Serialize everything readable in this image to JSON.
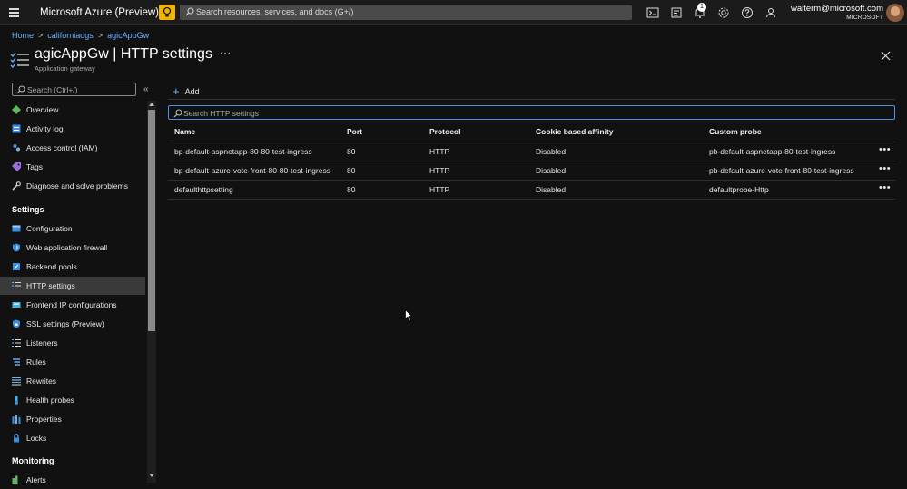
{
  "topbar": {
    "brand": "Microsoft Azure (Preview)",
    "search_placeholder": "Search resources, services, and docs (G+/)",
    "notification_count": "1",
    "account_email": "walterm@microsoft.com",
    "account_tenant": "MICROSOFT"
  },
  "breadcrumb": [
    "Home",
    "californiadgs",
    "agicAppGw"
  ],
  "header": {
    "title": "agicAppGw | HTTP settings",
    "subtitle": "Application gateway",
    "more": "···"
  },
  "sidebar": {
    "search_placeholder": "Search (Ctrl+/)",
    "collapse_glyph": "«",
    "top_items": [
      {
        "label": "Overview",
        "icon": "overview-icon"
      },
      {
        "label": "Activity log",
        "icon": "activity-log-icon"
      },
      {
        "label": "Access control (IAM)",
        "icon": "iam-icon"
      },
      {
        "label": "Tags",
        "icon": "tag-icon"
      },
      {
        "label": "Diagnose and solve problems",
        "icon": "wrench-icon"
      }
    ],
    "settings_heading": "Settings",
    "settings_items": [
      {
        "label": "Configuration",
        "icon": "configuration-icon"
      },
      {
        "label": "Web application firewall",
        "icon": "shield-icon"
      },
      {
        "label": "Backend pools",
        "icon": "backend-pools-icon"
      },
      {
        "label": "HTTP settings",
        "icon": "http-settings-icon",
        "active": true
      },
      {
        "label": "Frontend IP configurations",
        "icon": "frontend-ip-icon"
      },
      {
        "label": "SSL settings (Preview)",
        "icon": "ssl-shield-icon"
      },
      {
        "label": "Listeners",
        "icon": "listeners-icon"
      },
      {
        "label": "Rules",
        "icon": "rules-icon"
      },
      {
        "label": "Rewrites",
        "icon": "rewrites-icon"
      },
      {
        "label": "Health probes",
        "icon": "health-probe-icon"
      },
      {
        "label": "Properties",
        "icon": "properties-icon"
      },
      {
        "label": "Locks",
        "icon": "lock-icon"
      }
    ],
    "monitoring_heading": "Monitoring",
    "monitoring_items": [
      {
        "label": "Alerts",
        "icon": "alerts-icon"
      }
    ]
  },
  "commandbar": {
    "add_label": "Add"
  },
  "grid": {
    "search_placeholder": "Search HTTP settings",
    "columns": [
      "Name",
      "Port",
      "Protocol",
      "Cookie based affinity",
      "Custom probe"
    ],
    "rows": [
      [
        "bp-default-aspnetapp-80-80-test-ingress",
        "80",
        "HTTP",
        "Disabled",
        "pb-default-aspnetapp-80-test-ingress"
      ],
      [
        "bp-default-azure-vote-front-80-80-test-ingress",
        "80",
        "HTTP",
        "Disabled",
        "pb-default-azure-vote-front-80-test-ingress"
      ],
      [
        "defaulthttpsetting",
        "80",
        "HTTP",
        "Disabled",
        "defaultprobe-Http"
      ]
    ],
    "row_more": "•••"
  },
  "colors": {
    "accent": "#4d93e0",
    "link": "#6cb2ff",
    "preview_badge": "#f0b400",
    "background": "#111111"
  }
}
